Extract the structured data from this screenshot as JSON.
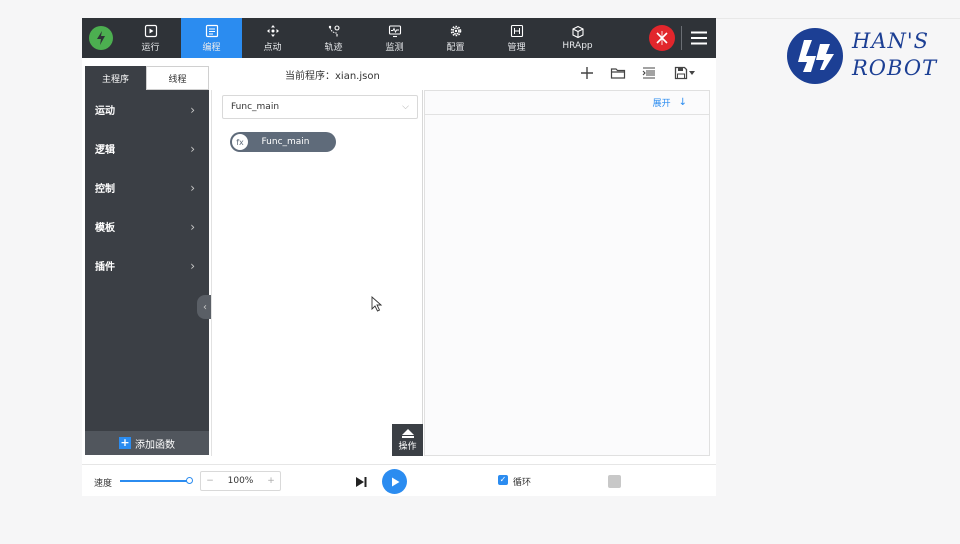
{
  "nav": {
    "items": [
      {
        "label": "运行",
        "icon": "play-icon"
      },
      {
        "label": "编程",
        "icon": "program-icon",
        "active": true
      },
      {
        "label": "点动",
        "icon": "move-icon"
      },
      {
        "label": "轨迹",
        "icon": "trajectory-icon"
      },
      {
        "label": "监测",
        "icon": "monitor-icon"
      },
      {
        "label": "配置",
        "icon": "gear-icon"
      },
      {
        "label": "管理",
        "icon": "manage-icon"
      },
      {
        "label": "HRApp",
        "icon": "cube-icon"
      }
    ]
  },
  "sidebar": {
    "tabs": [
      {
        "label": "主程序",
        "active": true
      },
      {
        "label": "线程",
        "active": false
      }
    ],
    "items": [
      {
        "label": "运动"
      },
      {
        "label": "逻辑"
      },
      {
        "label": "控制"
      },
      {
        "label": "模板"
      },
      {
        "label": "插件"
      }
    ],
    "add_function_label": "添加函数"
  },
  "toolbar": {
    "current_program": "当前程序：xian.json"
  },
  "function_panel": {
    "selected_function": "Func_main",
    "node_icon_text": "fx",
    "node_label": "Func_main"
  },
  "operation_button": {
    "label": "操作"
  },
  "detail_panel": {
    "expand_label": "展开",
    "expand_arrow": "↓"
  },
  "bottom": {
    "speed_label": "速度",
    "speed_value": "100%",
    "speed_fraction": 1.0,
    "loop_label": "循环",
    "loop_checked": true
  },
  "brand": {
    "line1": "HAN'S",
    "line2": "ROBOT"
  },
  "colors": {
    "nav_bg": "#2f3338",
    "accent": "#2b8cf0",
    "sidebar_bg": "#3b3f45",
    "estop": "#e2262c",
    "brand_blue": "#1c3f94"
  }
}
